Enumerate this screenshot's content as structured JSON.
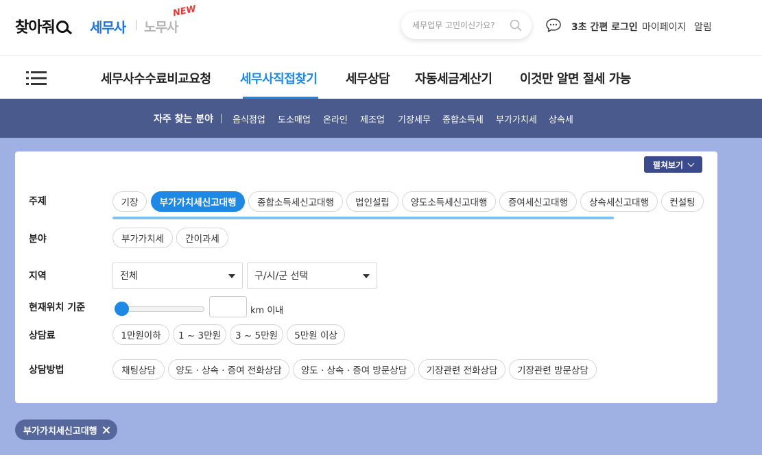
{
  "header": {
    "logo_text": "찾아줘",
    "brand_tax": "세무사",
    "brand_labor": "노무사",
    "new_badge": "NEW",
    "search_placeholder": "세무업무 고민이신가요?",
    "links": [
      "3초 간편 로그인",
      "마이페이지",
      "알림"
    ]
  },
  "nav": {
    "items": [
      "세무사수수료비교요청",
      "세무사직접찾기",
      "세무상담",
      "자동세금계산기",
      "이것만 알면 절세 가능"
    ],
    "active": "세무사직접찾기"
  },
  "subnav": {
    "title": "자주 찾는 분야",
    "items": [
      "음식점업",
      "도소매업",
      "온라인",
      "제조업",
      "기장세무",
      "종합소득세",
      "부가가치세",
      "상속세"
    ]
  },
  "filters": {
    "expand_label": "펼쳐보기",
    "topic": {
      "label": "주제",
      "chips": [
        "기장",
        "부가가치세신고대행",
        "종합소득세신고대행",
        "법인설립",
        "양도소득세신고대행",
        "증여세신고대행",
        "상속세신고대행",
        "컨설팅"
      ],
      "active": "부가가치세신고대행"
    },
    "field": {
      "label": "분야",
      "chips": [
        "부가가치세",
        "간이과세"
      ]
    },
    "region": {
      "label": "지역",
      "select1": "전체",
      "select2": "구/시/군 선택"
    },
    "location": {
      "label": "현재위치 기준",
      "unit": "km 이내",
      "slider_value": 0
    },
    "fee": {
      "label": "상담료",
      "chips": [
        "1만원이하",
        "1 ~ 3만원",
        "3 ~ 5만원",
        "5만원 이상"
      ]
    },
    "method": {
      "label": "상담방법",
      "chips": [
        "채팅상담",
        "양도 · 상속 · 증여 전화상담",
        "양도 · 상속 · 증여 방문상담",
        "기장관련 전화상담",
        "기장관련 방문상담"
      ]
    }
  },
  "selected_tags": [
    "부가가치세신고대행"
  ],
  "colors": {
    "accent": "#1e88e5",
    "subnav_bg": "#4a5a8c",
    "content_bg": "#9fb0e2",
    "tag_bg": "#56679c"
  }
}
